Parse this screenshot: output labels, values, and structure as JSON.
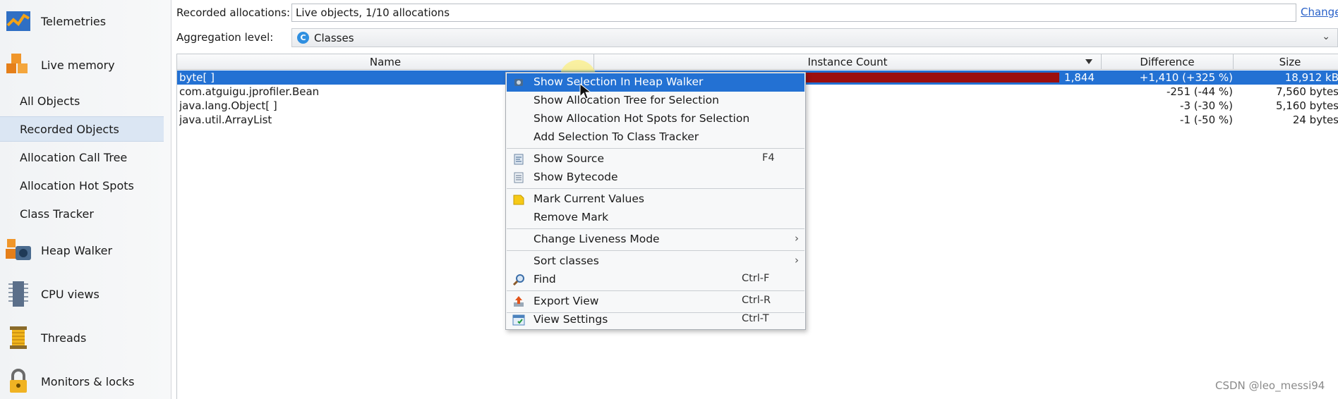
{
  "sidebar": {
    "main_items": [
      {
        "label": "Telemetries",
        "icon": "telemetries-icon"
      },
      {
        "label": "Live memory",
        "icon": "live-memory-icon"
      },
      {
        "label": "Heap Walker",
        "icon": "heap-walker-icon"
      },
      {
        "label": "CPU views",
        "icon": "cpu-views-icon"
      },
      {
        "label": "Threads",
        "icon": "threads-icon"
      },
      {
        "label": "Monitors & locks",
        "icon": "monitors-locks-icon"
      }
    ],
    "sub_items": [
      {
        "label": "All Objects"
      },
      {
        "label": "Recorded Objects",
        "selected": true
      },
      {
        "label": "Allocation Call Tree"
      },
      {
        "label": "Allocation Hot Spots"
      },
      {
        "label": "Class Tracker"
      }
    ]
  },
  "controls": {
    "recorded_label": "Recorded allocations:",
    "recorded_value": "Live objects, 1/10 allocations",
    "change_link": "Change",
    "aggregation_label": "Aggregation level:",
    "aggregation_value": "Classes",
    "aggregation_icon_letter": "C"
  },
  "table": {
    "columns": [
      "Name",
      "Instance Count",
      "Difference",
      "Size"
    ],
    "sorted_column": "Instance Count",
    "rows": [
      {
        "name": "byte[ ]",
        "count": "1,844",
        "count_fraction": 1.0,
        "difference": "+1,410 (+325 %)",
        "size": "18,912 kB",
        "selected": true
      },
      {
        "name": "com.atguigu.jprofiler.Bean",
        "count": "",
        "difference": "-251 (-44 %)",
        "size": "7,560 bytes"
      },
      {
        "name": "java.lang.Object[ ]",
        "count": "",
        "difference": "-3 (-30 %)",
        "size": "5,160 bytes"
      },
      {
        "name": "java.util.ArrayList",
        "count": "",
        "difference": "-1 (-50 %)",
        "size": "24 bytes"
      }
    ]
  },
  "context_menu": {
    "groups": [
      [
        {
          "label": "Show Selection In Heap Walker",
          "icon": "heap-walker-small-icon",
          "highlighted": true
        },
        {
          "label": "Show Allocation Tree for Selection"
        },
        {
          "label": "Show Allocation Hot Spots for Selection"
        },
        {
          "label": "Add Selection To Class Tracker"
        }
      ],
      [
        {
          "label": "Show Source",
          "icon": "source-icon",
          "shortcut": "F4"
        },
        {
          "label": "Show Bytecode",
          "icon": "bytecode-icon"
        }
      ],
      [
        {
          "label": "Mark Current Values",
          "icon": "mark-icon"
        },
        {
          "label": "Remove Mark"
        }
      ],
      [
        {
          "label": "Change Liveness Mode",
          "submenu": true
        }
      ],
      [
        {
          "label": "Sort classes",
          "submenu": true
        },
        {
          "label": "Find",
          "icon": "find-icon",
          "shortcut": "Ctrl-F"
        }
      ],
      [
        {
          "label": "Export View",
          "icon": "export-icon",
          "shortcut": "Ctrl-R"
        }
      ],
      [
        {
          "label": "View Settings",
          "icon": "view-settings-icon",
          "shortcut": "Ctrl-T"
        }
      ]
    ]
  },
  "watermark": "CSDN @leo_messi94",
  "colors": {
    "selection": "#2371d3",
    "bar": "#9c0f0f",
    "link": "#2a62c9"
  }
}
